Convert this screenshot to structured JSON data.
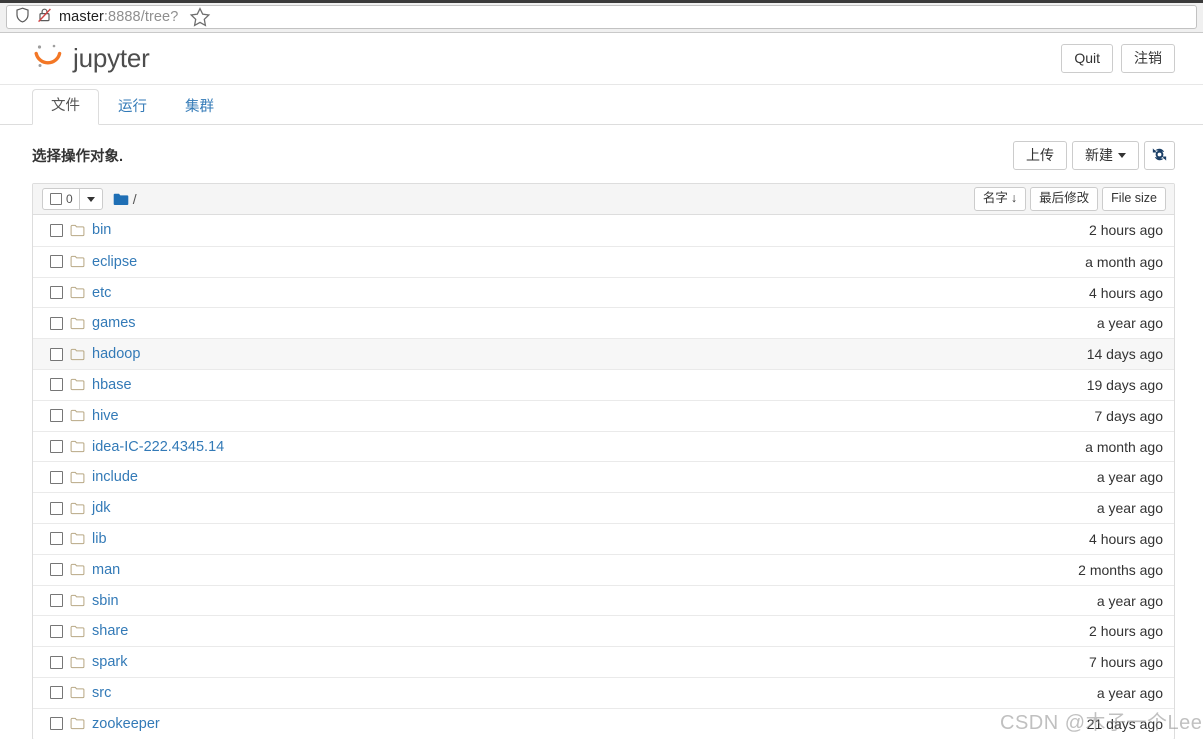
{
  "browser": {
    "url_host": "master",
    "url_rest": ":8888/tree?",
    "shield_icon": "shield-icon",
    "lock_icon": "lock-crossed-icon",
    "star_icon": "bookmark-star-icon"
  },
  "header": {
    "logo_text": "jupyter",
    "logo_icon": "jupyter-logo-icon",
    "quit_label": "Quit",
    "logout_label": "注销"
  },
  "tabs": [
    {
      "label": "文件",
      "active": true
    },
    {
      "label": "运行",
      "active": false
    },
    {
      "label": "集群",
      "active": false
    }
  ],
  "toolbar": {
    "title": "选择操作对象.",
    "upload_label": "上传",
    "new_label": "新建",
    "refresh_icon": "refresh-icon"
  },
  "list_header": {
    "selected_count": "0",
    "select_all_icon": "checkbox-icon",
    "dropdown_icon": "chevron-down-icon",
    "folder_icon": "folder-filled-icon",
    "path": "/",
    "sort_name_label": "名字",
    "sort_name_arrow": "↓",
    "sort_modified_label": "最后修改",
    "sort_size_label": "File size"
  },
  "files": [
    {
      "name": "bin",
      "modified": "2 hours ago",
      "hovered": false
    },
    {
      "name": "eclipse",
      "modified": "a month ago",
      "hovered": false
    },
    {
      "name": "etc",
      "modified": "4 hours ago",
      "hovered": false
    },
    {
      "name": "games",
      "modified": "a year ago",
      "hovered": false
    },
    {
      "name": "hadoop",
      "modified": "14 days ago",
      "hovered": true
    },
    {
      "name": "hbase",
      "modified": "19 days ago",
      "hovered": false
    },
    {
      "name": "hive",
      "modified": "7 days ago",
      "hovered": false
    },
    {
      "name": "idea-IC-222.4345.14",
      "modified": "a month ago",
      "hovered": false
    },
    {
      "name": "include",
      "modified": "a year ago",
      "hovered": false
    },
    {
      "name": "jdk",
      "modified": "a year ago",
      "hovered": false
    },
    {
      "name": "lib",
      "modified": "4 hours ago",
      "hovered": false
    },
    {
      "name": "man",
      "modified": "2 months ago",
      "hovered": false
    },
    {
      "name": "sbin",
      "modified": "a year ago",
      "hovered": false
    },
    {
      "name": "share",
      "modified": "2 hours ago",
      "hovered": false
    },
    {
      "name": "spark",
      "modified": "7 hours ago",
      "hovered": false
    },
    {
      "name": "src",
      "modified": "a year ago",
      "hovered": false
    },
    {
      "name": "zookeeper",
      "modified": "21 days ago",
      "hovered": false
    }
  ],
  "watermark": {
    "text": "CSDN @木子一个Lee"
  },
  "colors": {
    "link": "#337ab7",
    "accent_orange": "#f37726",
    "folder_icon": "#b8a884",
    "header_bg": "#f5f5f5",
    "border": "#dddddd",
    "row_hover": "#f7f7f7"
  }
}
